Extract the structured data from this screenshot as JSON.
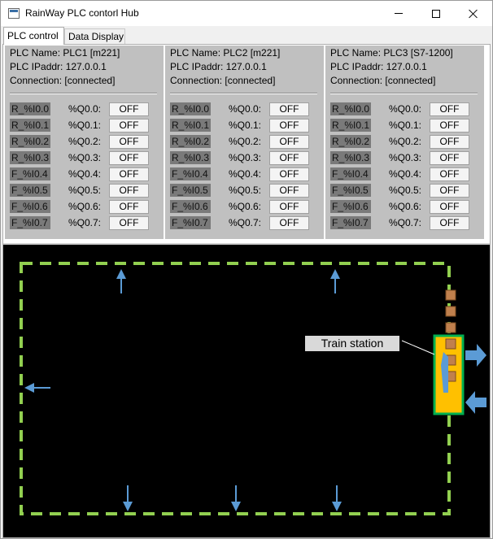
{
  "window": {
    "title": "RainWay PLC contorl Hub"
  },
  "tabs": [
    {
      "label": "PLC control",
      "active": true
    },
    {
      "label": "Data Display",
      "active": false
    }
  ],
  "plcs": [
    {
      "name": "PLC Name: PLC1 [m221]",
      "ip": "PLC IPaddr: 127.0.0.1",
      "connection": "Connection: [connected]",
      "rows": [
        {
          "input": "R_%I0.0",
          "output": "%Q0.0:",
          "state": "OFF"
        },
        {
          "input": "R_%I0.1",
          "output": "%Q0.1:",
          "state": "OFF"
        },
        {
          "input": "R_%I0.2",
          "output": "%Q0.2:",
          "state": "OFF"
        },
        {
          "input": "R_%I0.3",
          "output": "%Q0.3:",
          "state": "OFF"
        },
        {
          "input": "F_%I0.4",
          "output": "%Q0.4:",
          "state": "OFF"
        },
        {
          "input": "F_%I0.5",
          "output": "%Q0.5:",
          "state": "OFF"
        },
        {
          "input": "F_%I0.6",
          "output": "%Q0.6:",
          "state": "OFF"
        },
        {
          "input": "F_%I0.7",
          "output": "%Q0.7:",
          "state": "OFF"
        }
      ]
    },
    {
      "name": "PLC Name: PLC2 [m221]",
      "ip": "PLC IPaddr: 127.0.0.1",
      "connection": "Connection: [connected]",
      "rows": [
        {
          "input": "R_%I0.0",
          "output": "%Q0.0:",
          "state": "OFF"
        },
        {
          "input": "R_%I0.1",
          "output": "%Q0.1:",
          "state": "OFF"
        },
        {
          "input": "R_%I0.2",
          "output": "%Q0.2:",
          "state": "OFF"
        },
        {
          "input": "R_%I0.3",
          "output": "%Q0.3:",
          "state": "OFF"
        },
        {
          "input": "F_%I0.4",
          "output": "%Q0.4:",
          "state": "OFF"
        },
        {
          "input": "F_%I0.5",
          "output": "%Q0.5:",
          "state": "OFF"
        },
        {
          "input": "F_%I0.6",
          "output": "%Q0.6:",
          "state": "OFF"
        },
        {
          "input": "F_%I0.7",
          "output": "%Q0.7:",
          "state": "OFF"
        }
      ]
    },
    {
      "name": "PLC Name: PLC3 [S7-1200]",
      "ip": "PLC IPaddr: 127.0.0.1",
      "connection": "Connection: [connected]",
      "rows": [
        {
          "input": "R_%I0.0",
          "output": "%Q0.0:",
          "state": "OFF"
        },
        {
          "input": "R_%I0.1",
          "output": "%Q0.1:",
          "state": "OFF"
        },
        {
          "input": "R_%I0.2",
          "output": "%Q0.2:",
          "state": "OFF"
        },
        {
          "input": "R_%I0.3",
          "output": "%Q0.3:",
          "state": "OFF"
        },
        {
          "input": "F_%I0.4",
          "output": "%Q0.4:",
          "state": "OFF"
        },
        {
          "input": "F_%I0.5",
          "output": "%Q0.5:",
          "state": "OFF"
        },
        {
          "input": "F_%I0.6",
          "output": "%Q0.6:",
          "state": "OFF"
        },
        {
          "input": "F_%I0.7",
          "output": "%Q0.7:",
          "state": "OFF"
        }
      ]
    }
  ],
  "railway": {
    "station_label": "Train station",
    "colors": {
      "track": "#92d050",
      "arrow": "#5b9bd5",
      "station_fill": "#ffc000",
      "station_border": "#00b050",
      "train_car": "#c0804d",
      "background": "#000000"
    },
    "icons": [
      "direction-arrow-icon",
      "train-car-icon",
      "station-icon"
    ]
  }
}
